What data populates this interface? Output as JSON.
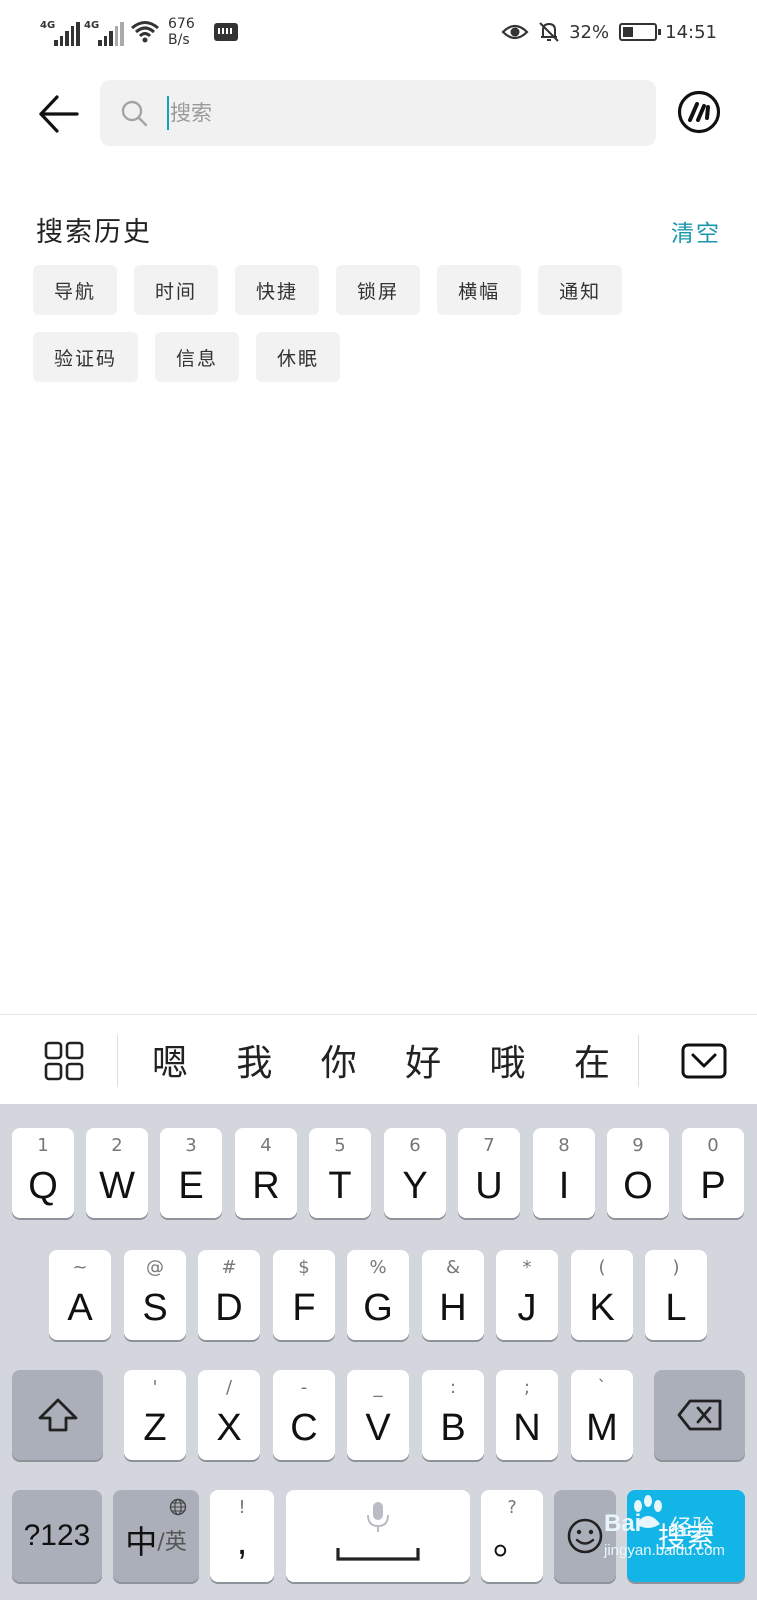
{
  "status_bar": {
    "network_1": "4G",
    "network_2": "4G",
    "speed_value": "676",
    "speed_unit": "B/s",
    "battery_percent": "32%",
    "battery_level": 0.32,
    "time": "14:51"
  },
  "search": {
    "placeholder": "搜索",
    "value": ""
  },
  "history": {
    "title": "搜索历史",
    "clear_label": "清空",
    "items": [
      "导航",
      "时间",
      "快捷",
      "锁屏",
      "横幅",
      "通知",
      "验证码",
      "信息",
      "休眠"
    ]
  },
  "candidates": {
    "words": [
      "嗯",
      "我",
      "你",
      "好",
      "哦",
      "在"
    ]
  },
  "keyboard": {
    "row1": [
      {
        "hint": "1",
        "key": "Q"
      },
      {
        "hint": "2",
        "key": "W"
      },
      {
        "hint": "3",
        "key": "E"
      },
      {
        "hint": "4",
        "key": "R"
      },
      {
        "hint": "5",
        "key": "T"
      },
      {
        "hint": "6",
        "key": "Y"
      },
      {
        "hint": "7",
        "key": "U"
      },
      {
        "hint": "8",
        "key": "I"
      },
      {
        "hint": "9",
        "key": "O"
      },
      {
        "hint": "0",
        "key": "P"
      }
    ],
    "row2": [
      {
        "hint": "~",
        "key": "A"
      },
      {
        "hint": "@",
        "key": "S"
      },
      {
        "hint": "#",
        "key": "D"
      },
      {
        "hint": "$",
        "key": "F"
      },
      {
        "hint": "%",
        "key": "G"
      },
      {
        "hint": "&",
        "key": "H"
      },
      {
        "hint": "*",
        "key": "J"
      },
      {
        "hint": "(",
        "key": "K"
      },
      {
        "hint": ")",
        "key": "L"
      }
    ],
    "row3": [
      {
        "hint": "'",
        "key": "Z"
      },
      {
        "hint": "/",
        "key": "X"
      },
      {
        "hint": "-",
        "key": "C"
      },
      {
        "hint": "_",
        "key": "V"
      },
      {
        "hint": ":",
        "key": "B"
      },
      {
        "hint": ";",
        "key": "N"
      },
      {
        "hint": "`",
        "key": "M"
      }
    ],
    "num_label": "?123",
    "lang_main": "中",
    "lang_alt": "/英",
    "comma_hint": "!",
    "comma_key": ",",
    "period_hint": "?",
    "period_key": "。",
    "search_label": "搜索"
  },
  "watermark": {
    "brand": "Bai",
    "brand_cn": "经验",
    "site": "jingyan.baidu.com"
  },
  "colors": {
    "accent": "#1b97ad",
    "cursor": "#13a4b3",
    "chip_bg": "#f2f2f2",
    "keyboard_bg": "#d3d6dd",
    "key_dark": "#abafba",
    "search_key": "#13b5e6"
  },
  "icons": {
    "back": "arrow-left-icon",
    "search": "search-icon",
    "voice": "voice-assistant-icon",
    "grid": "grid-icon",
    "hide": "keyboard-hide-icon",
    "shift": "shift-icon",
    "delete": "backspace-icon",
    "mic": "microphone-icon",
    "emoji": "emoji-icon",
    "globe": "globe-icon"
  }
}
